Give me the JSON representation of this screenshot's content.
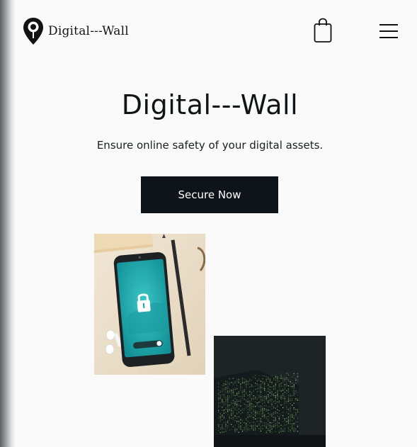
{
  "brand": {
    "name": "Digital---Wall"
  },
  "header": {
    "cart_icon": "shopping-bag-icon",
    "menu_icon": "hamburger-menu-icon"
  },
  "hero": {
    "title": "Digital---Wall",
    "subtitle": "Ensure online safety of your digital assets.",
    "cta_label": "Secure Now"
  },
  "gallery": {
    "images": [
      {
        "name": "phone-security-image",
        "phone_screen_text": "Secure"
      },
      {
        "name": "laptop-code-image"
      }
    ]
  },
  "colors": {
    "background": "#fafafa",
    "text": "#121417",
    "cta_background": "#0f141a",
    "cta_text": "#ffffff",
    "phone_screen": "#19a7ab"
  }
}
